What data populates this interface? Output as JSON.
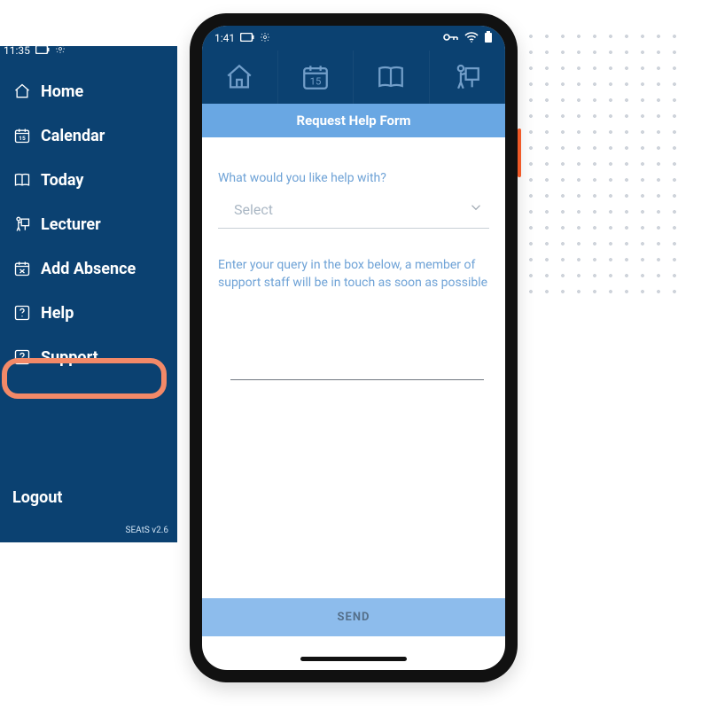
{
  "sidebar": {
    "status_time": "11:35",
    "items": [
      {
        "label": "Home"
      },
      {
        "label": "Calendar"
      },
      {
        "label": "Today"
      },
      {
        "label": "Lecturer"
      },
      {
        "label": "Add Absence"
      },
      {
        "label": "Help"
      },
      {
        "label": "Support"
      }
    ],
    "logout_label": "Logout",
    "version": "SEAtS v2.6"
  },
  "phone": {
    "status_time": "1:41",
    "form_title": "Request Help Form",
    "question1": "What would you like help with?",
    "select_placeholder": "Select",
    "question2": "Enter your query in the box below, a member of support staff will be in touch as soon as possible",
    "send_label": "SEND"
  }
}
